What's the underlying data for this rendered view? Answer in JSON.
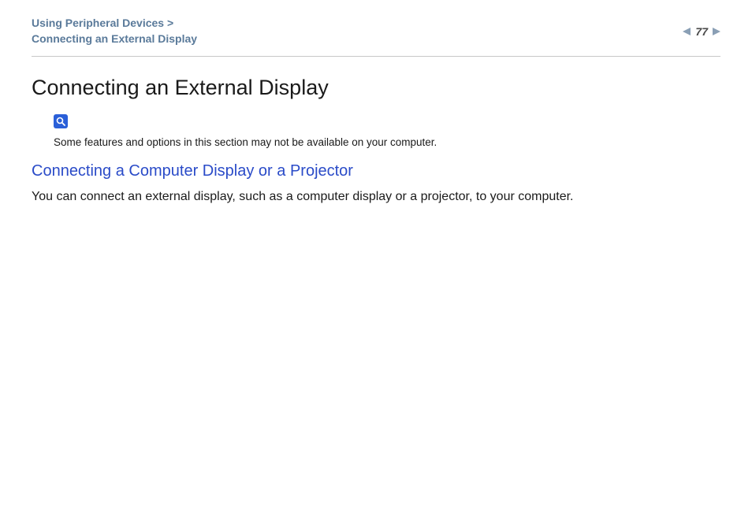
{
  "header": {
    "breadcrumb_line1": "Using Peripheral Devices >",
    "breadcrumb_line2": "Connecting an External Display",
    "page_number": "77"
  },
  "content": {
    "title": "Connecting an External Display",
    "note": "Some features and options in this section may not be available on your computer.",
    "section_heading": "Connecting a Computer Display or a Projector",
    "body": "You can connect an external display, such as a computer display or a projector, to your computer."
  }
}
